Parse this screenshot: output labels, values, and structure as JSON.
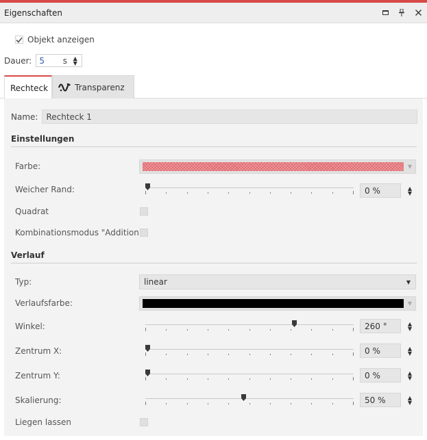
{
  "window": {
    "title": "Eigenschaften",
    "controls": [
      "maximize-icon",
      "pin-icon",
      "close-icon"
    ]
  },
  "show_object": {
    "label": "Objekt anzeigen",
    "checked": true
  },
  "duration": {
    "label": "Dauer:",
    "value": "5",
    "unit": "s"
  },
  "tabs": [
    {
      "label": "Rechteck",
      "active": true
    },
    {
      "label": "Transparenz",
      "active": false,
      "icon": "wave-icon"
    }
  ],
  "name": {
    "label": "Name:",
    "value": "Rechteck 1"
  },
  "settings": {
    "heading": "Einstellungen",
    "color": {
      "label": "Farbe:",
      "value_color": "#e06a70"
    },
    "soft_edge": {
      "label": "Weicher Rand:",
      "value": "0 %",
      "level": 0
    },
    "square": {
      "label": "Quadrat",
      "checked": false
    },
    "blend_mode": {
      "label": "Kombinationsmodus \"Addition\"",
      "checked": false
    }
  },
  "gradient": {
    "heading": "Verlauf",
    "type": {
      "label": "Typ:",
      "value": "linear"
    },
    "color": {
      "label": "Verlaufsfarbe:",
      "value_color": "#000000"
    },
    "angle": {
      "label": "Winkel:",
      "value": "260 °",
      "level": 0.72
    },
    "center_x": {
      "label": "Zentrum X:",
      "value": "0 %",
      "level": 0
    },
    "center_y": {
      "label": "Zentrum Y:",
      "value": "0 %",
      "level": 0
    },
    "scale": {
      "label": "Skalierung:",
      "value": "50 %",
      "level": 0.47
    },
    "keep": {
      "label": "Liegen lassen",
      "checked": false
    }
  },
  "colors": {
    "accent": "#d84a4a",
    "link_blue": "#2b5fa8"
  }
}
